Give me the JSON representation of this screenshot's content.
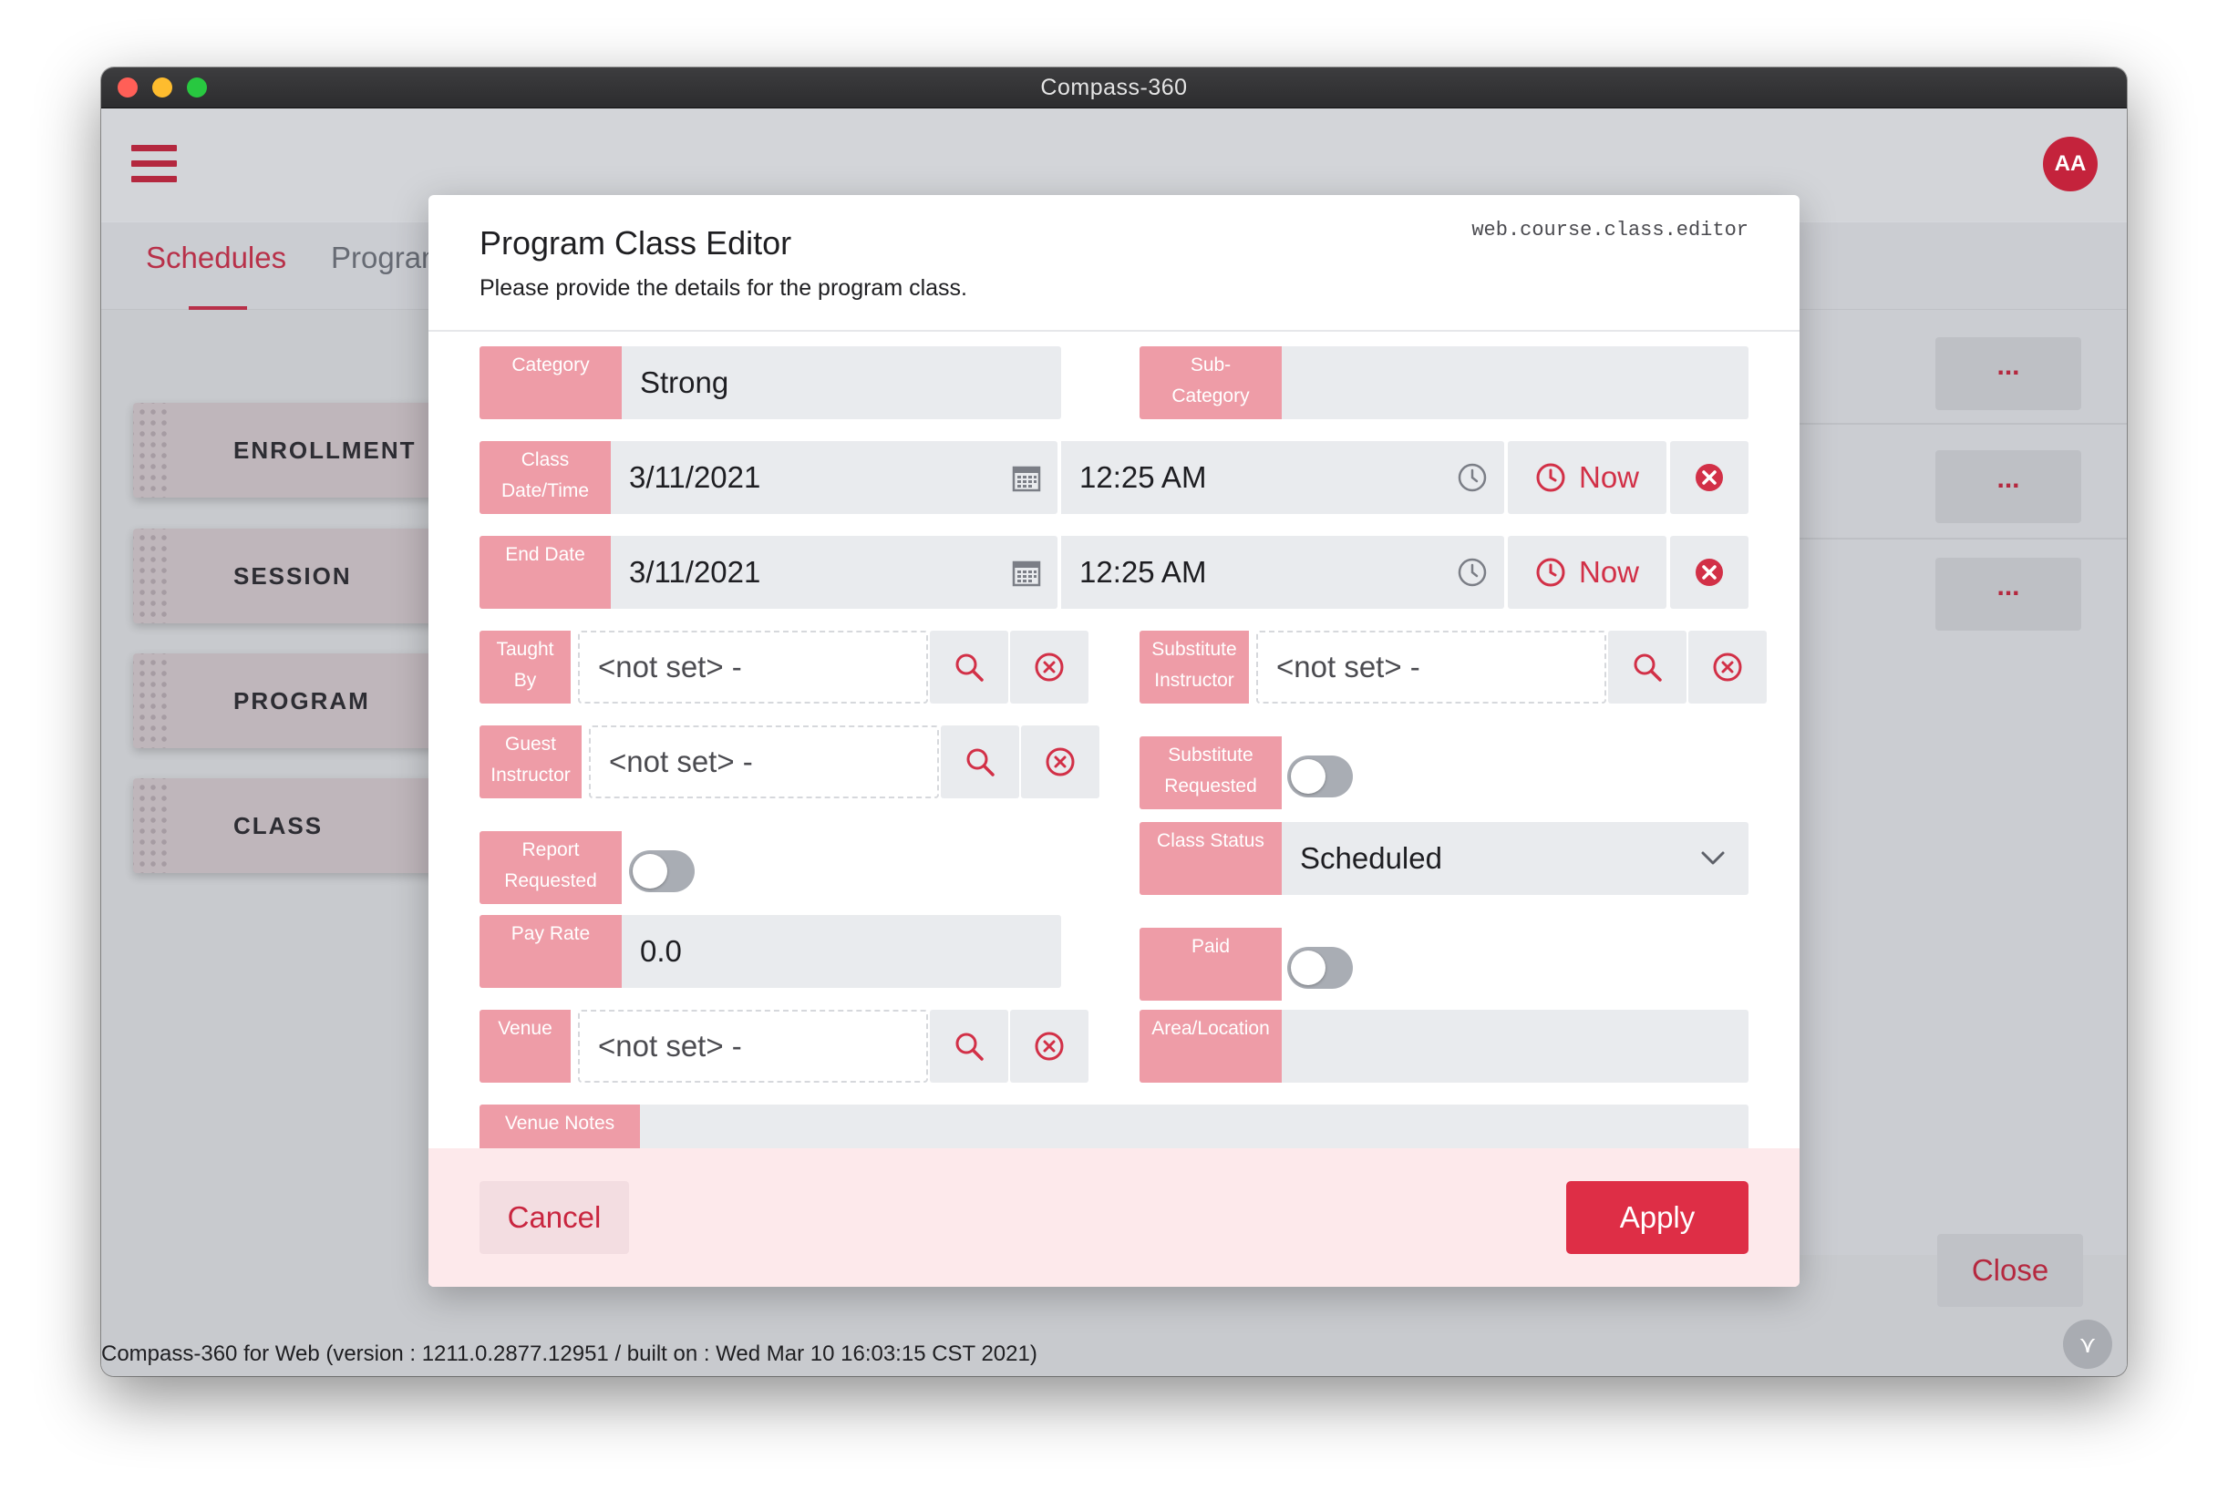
{
  "window": {
    "title": "Compass-360"
  },
  "header": {
    "avatar_initials": "AA"
  },
  "tabs": [
    {
      "label": "Schedules"
    },
    {
      "label": "Programs"
    }
  ],
  "sidebar": {
    "items": [
      {
        "label": "ENROLLMENT"
      },
      {
        "label": "SESSION"
      },
      {
        "label": "PROGRAM"
      },
      {
        "label": "CLASS"
      }
    ]
  },
  "right_panel": {
    "more_label": "...",
    "close_label": "Close"
  },
  "footer": {
    "version_text": "Compass-360 for Web (version : 1211.0.2877.12951 / built on : Wed Mar 10 16:03:15 CST 2021)"
  },
  "dialog": {
    "title": "Program Class Editor",
    "subtitle": "Please provide the details for the program class.",
    "code": "web.course.class.editor",
    "cancel_label": "Cancel",
    "apply_label": "Apply",
    "fields": {
      "category": {
        "label": "Category",
        "value": "Strong"
      },
      "sub_category": {
        "label_line1": "Sub-",
        "label_line2": "Category",
        "value": ""
      },
      "class_datetime": {
        "label_line1": "Class",
        "label_line2": "Date/Time",
        "date": "3/11/2021",
        "time": "12:25 AM",
        "now_label": "Now"
      },
      "end_date": {
        "label": "End Date",
        "date": "3/11/2021",
        "time": "12:25 AM",
        "now_label": "Now"
      },
      "taught_by": {
        "label_line1": "Taught",
        "label_line2": "By",
        "value": "<not set> -"
      },
      "substitute_instructor": {
        "label_line1": "Substitute",
        "label_line2": "Instructor",
        "value": "<not set> -"
      },
      "guest_instructor": {
        "label_line1": "Guest",
        "label_line2": "Instructor",
        "value": "<not set> -"
      },
      "substitute_requested": {
        "label_line1": "Substitute",
        "label_line2": "Requested",
        "on": false
      },
      "report_requested": {
        "label_line1": "Report",
        "label_line2": "Requested",
        "on": false
      },
      "class_status": {
        "label": "Class Status",
        "value": "Scheduled"
      },
      "pay_rate": {
        "label": "Pay Rate",
        "value": "0.0"
      },
      "paid": {
        "label": "Paid",
        "on": false
      },
      "venue": {
        "label": "Venue",
        "value": "<not set> -"
      },
      "area_location": {
        "label": "Area/Location",
        "value": ""
      },
      "venue_notes": {
        "label": "Venue Notes",
        "value": ""
      }
    }
  },
  "icons": {
    "calendar": "calendar-icon",
    "clock": "clock-icon",
    "search": "search-icon",
    "clear": "clear-icon",
    "chevron": "chevron-down-icon"
  },
  "colors": {
    "accent": "#de2e46",
    "label_bg": "#ee9ca7",
    "field_bg": "#e9ebee"
  }
}
